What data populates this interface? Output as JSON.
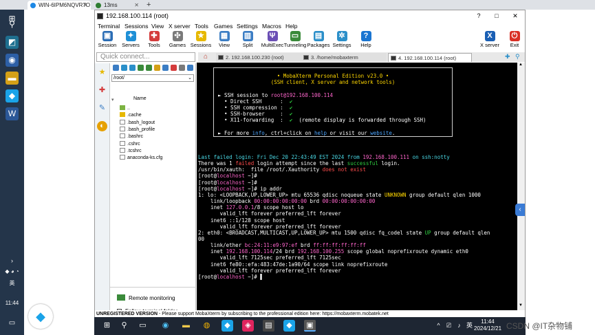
{
  "browser": {
    "tabs": [
      {
        "label": "WIN-6IPM6NQVR7O",
        "color": "#1e88e5"
      },
      {
        "label": "13ms",
        "color": "#2e7d32"
      }
    ],
    "new_tab": "+"
  },
  "remote_taskbar_left": {
    "time": "11:44",
    "lang": "英"
  },
  "window": {
    "title": "192.168.100.114 (root)",
    "controls": {
      "minimize": "?",
      "restore": "□",
      "close": "✕"
    },
    "menu": [
      "Terminal",
      "Sessions",
      "View",
      "X server",
      "Tools",
      "Games",
      "Settings",
      "Macros",
      "Help"
    ],
    "toolbar": [
      {
        "label": "Session",
        "icon": "session-icon",
        "color": "#2a6db5",
        "glyph": "▣"
      },
      {
        "label": "Servers",
        "icon": "servers-icon",
        "color": "#1e8fd6",
        "glyph": "✦"
      },
      {
        "label": "Tools",
        "icon": "tools-icon",
        "color": "#d43b3b",
        "glyph": "✚"
      },
      {
        "label": "Games",
        "icon": "games-icon",
        "color": "#7a7a7a",
        "glyph": "✣"
      },
      {
        "label": "Sessions",
        "icon": "sessions-star-icon",
        "color": "#e6b800",
        "glyph": "★"
      },
      {
        "label": "View",
        "icon": "view-icon",
        "color": "#3b7dc4",
        "glyph": "▦"
      },
      {
        "label": "Split",
        "icon": "split-icon",
        "color": "#3b7dc4",
        "glyph": "▥"
      },
      {
        "label": "MultiExec",
        "icon": "multiexec-icon",
        "color": "#6b4fb5",
        "glyph": "Ψ"
      },
      {
        "label": "Tunneling",
        "icon": "tunneling-icon",
        "color": "#3a8a3a",
        "glyph": "▭"
      },
      {
        "label": "Packages",
        "icon": "packages-icon",
        "color": "#2b8fc9",
        "glyph": "▤"
      },
      {
        "label": "Settings",
        "icon": "settings-icon",
        "color": "#2b8fc9",
        "glyph": "✲"
      },
      {
        "label": "Help",
        "icon": "help-icon",
        "color": "#1a75d1",
        "glyph": "?"
      }
    ],
    "toolbar_right": [
      {
        "label": "X server",
        "icon": "x-server-icon",
        "color": "#1a5fb4",
        "glyph": "X"
      },
      {
        "label": "Exit",
        "icon": "exit-icon",
        "color": "#d93025",
        "glyph": "⏻"
      }
    ],
    "quick_connect_placeholder": "Quick connect...",
    "session_tabs": [
      {
        "label": "2. 192.168.100.230 (root)"
      },
      {
        "label": "3. /home/mobaxterm"
      },
      {
        "label": "4. 192.168.100.114 (root)"
      }
    ]
  },
  "sftp": {
    "path": "/root/",
    "column_header": "Name",
    "files": [
      {
        "name": "..",
        "type": "up"
      },
      {
        "name": ".cache",
        "type": "folder"
      },
      {
        "name": ".bash_logout",
        "type": "file"
      },
      {
        "name": ".bash_profile",
        "type": "file"
      },
      {
        "name": ".bashrc",
        "type": "file"
      },
      {
        "name": ".cshrc",
        "type": "file"
      },
      {
        "name": ".tcshrc",
        "type": "file"
      },
      {
        "name": "anaconda-ks.cfg",
        "type": "file"
      }
    ],
    "remote_monitoring": "Remote monitoring",
    "follow_folder": "Follow terminal folder"
  },
  "terminal": {
    "banner": [
      [
        {
          "t": "• MobaXterm Personal Edition v23.0 •",
          "c": "#ffd700"
        }
      ],
      [
        {
          "t": "(SSH client, X server and network tools)",
          "c": "#ffd700"
        }
      ],
      [
        {
          "t": "",
          "c": "#fff"
        }
      ],
      [
        {
          "t": "► SSH session to ",
          "c": "#fff"
        },
        {
          "t": "root@192.168.100.114",
          "c": "#ff66cc"
        }
      ],
      [
        {
          "t": "  • Direct SSH      :  ",
          "c": "#fff"
        },
        {
          "t": "✔",
          "c": "#2ecc40"
        }
      ],
      [
        {
          "t": "  • SSH compression :  ",
          "c": "#fff"
        },
        {
          "t": "✔",
          "c": "#2ecc40"
        }
      ],
      [
        {
          "t": "  • SSH-browser     :  ",
          "c": "#fff"
        },
        {
          "t": "✔",
          "c": "#2ecc40"
        }
      ],
      [
        {
          "t": "  • X11-forwarding  :  ",
          "c": "#fff"
        },
        {
          "t": "✔",
          "c": "#2ecc40"
        },
        {
          "t": "  (remote display is forwarded through SSH)",
          "c": "#fff"
        }
      ],
      [
        {
          "t": "",
          "c": "#fff"
        }
      ],
      [
        {
          "t": "► For more ",
          "c": "#fff"
        },
        {
          "t": "info",
          "c": "#4da6ff"
        },
        {
          "t": ", ctrl+click on ",
          "c": "#fff"
        },
        {
          "t": "help",
          "c": "#4da6ff"
        },
        {
          "t": " or visit our ",
          "c": "#fff"
        },
        {
          "t": "website",
          "c": "#4da6ff"
        },
        {
          "t": ".",
          "c": "#fff"
        }
      ]
    ],
    "lines": [
      [
        {
          "t": "Last failed login: Fri Dec 20 22:43:49 EST 2024 from ",
          "c": "#4ad9e6"
        },
        {
          "t": "192.168.100.111",
          "c": "#ff66cc"
        },
        {
          "t": " on ssh:notty",
          "c": "#4ad9e6"
        }
      ],
      [
        {
          "t": "There was 1 ",
          "c": "#fff"
        },
        {
          "t": "failed",
          "c": "#ff4d4d"
        },
        {
          "t": " login attempt since the last ",
          "c": "#fff"
        },
        {
          "t": "successful",
          "c": "#2ecc40"
        },
        {
          "t": " login.",
          "c": "#fff"
        }
      ],
      [
        {
          "t": "/usr/bin/xauth:  file /root/.Xauthority ",
          "c": "#fff"
        },
        {
          "t": "does not exist",
          "c": "#ff4d4d"
        }
      ],
      [
        {
          "t": "[root@",
          "c": "#fff"
        },
        {
          "t": "localhost",
          "c": "#ff66cc"
        },
        {
          "t": " ~]#",
          "c": "#fff"
        }
      ],
      [
        {
          "t": "[root@",
          "c": "#fff"
        },
        {
          "t": "localhost",
          "c": "#ff66cc"
        },
        {
          "t": " ~]#",
          "c": "#fff"
        }
      ],
      [
        {
          "t": "[root@",
          "c": "#fff"
        },
        {
          "t": "localhost",
          "c": "#ff66cc"
        },
        {
          "t": " ~]# ip addr",
          "c": "#fff"
        }
      ],
      [
        {
          "t": "1: lo: <LOOPBACK,UP,LOWER_UP> mtu 65536 qdisc noqueue state ",
          "c": "#fff"
        },
        {
          "t": "UNKNOWN",
          "c": "#ffd700"
        },
        {
          "t": " group default qlen 1000",
          "c": "#fff"
        }
      ],
      [
        {
          "t": "    link/loopback ",
          "c": "#fff"
        },
        {
          "t": "00:00:00:00:00:00",
          "c": "#ff66cc"
        },
        {
          "t": " brd ",
          "c": "#fff"
        },
        {
          "t": "00:00:00:00:00:00",
          "c": "#ff66cc"
        }
      ],
      [
        {
          "t": "    inet ",
          "c": "#fff"
        },
        {
          "t": "127.0.0.1",
          "c": "#ff66cc"
        },
        {
          "t": "/8 scope host lo",
          "c": "#fff"
        }
      ],
      [
        {
          "t": "       valid_lft forever preferred_lft forever",
          "c": "#fff"
        }
      ],
      [
        {
          "t": "    inet6 ::1/128 scope host",
          "c": "#fff"
        }
      ],
      [
        {
          "t": "       valid_lft forever preferred_lft forever",
          "c": "#fff"
        }
      ],
      [
        {
          "t": "2: eth0: <BROADCAST,MULTICAST,UP,LOWER_UP> mtu 1500 qdisc fq_codel state ",
          "c": "#fff"
        },
        {
          "t": "UP",
          "c": "#2ecc40"
        },
        {
          "t": " group default qlen",
          "c": "#fff"
        }
      ],
      [
        {
          "t": "00",
          "c": "#fff"
        }
      ],
      [
        {
          "t": "    link/ether ",
          "c": "#fff"
        },
        {
          "t": "bc:24:11:e9:97:ef",
          "c": "#ff66cc"
        },
        {
          "t": " brd ",
          "c": "#fff"
        },
        {
          "t": "ff:ff:ff:ff:ff:ff",
          "c": "#ff66cc"
        }
      ],
      [
        {
          "t": "    inet ",
          "c": "#fff"
        },
        {
          "t": "192.168.100.114",
          "c": "#ff66cc"
        },
        {
          "t": "/24 brd ",
          "c": "#fff"
        },
        {
          "t": "192.168.100.255",
          "c": "#ff66cc"
        },
        {
          "t": " scope global noprefixroute dynamic eth0",
          "c": "#fff"
        }
      ],
      [
        {
          "t": "       valid_lft 7125sec preferred_lft 7125sec",
          "c": "#fff"
        }
      ],
      [
        {
          "t": "    inet6 fe80::efa:483:47de:1a90/64 scope link noprefixroute",
          "c": "#fff"
        }
      ],
      [
        {
          "t": "       valid_lft forever preferred_lft forever",
          "c": "#fff"
        }
      ],
      [
        {
          "t": "[root@",
          "c": "#fff"
        },
        {
          "t": "localhost",
          "c": "#ff66cc"
        },
        {
          "t": " ~]# ",
          "c": "#fff"
        },
        {
          "t": "▌",
          "c": "#fff"
        }
      ]
    ]
  },
  "status": {
    "label": "UNREGISTERED VERSION",
    "message": "  -  Please support MobaXterm by subscribing to the professional edition here:  https://mobaxterm.mobatek.net"
  },
  "taskbar": {
    "lang": "英",
    "time": "11:44",
    "date": "2024/12/21",
    "tray_up": "^"
  },
  "watermark": "CSDN @IT杂物铺"
}
